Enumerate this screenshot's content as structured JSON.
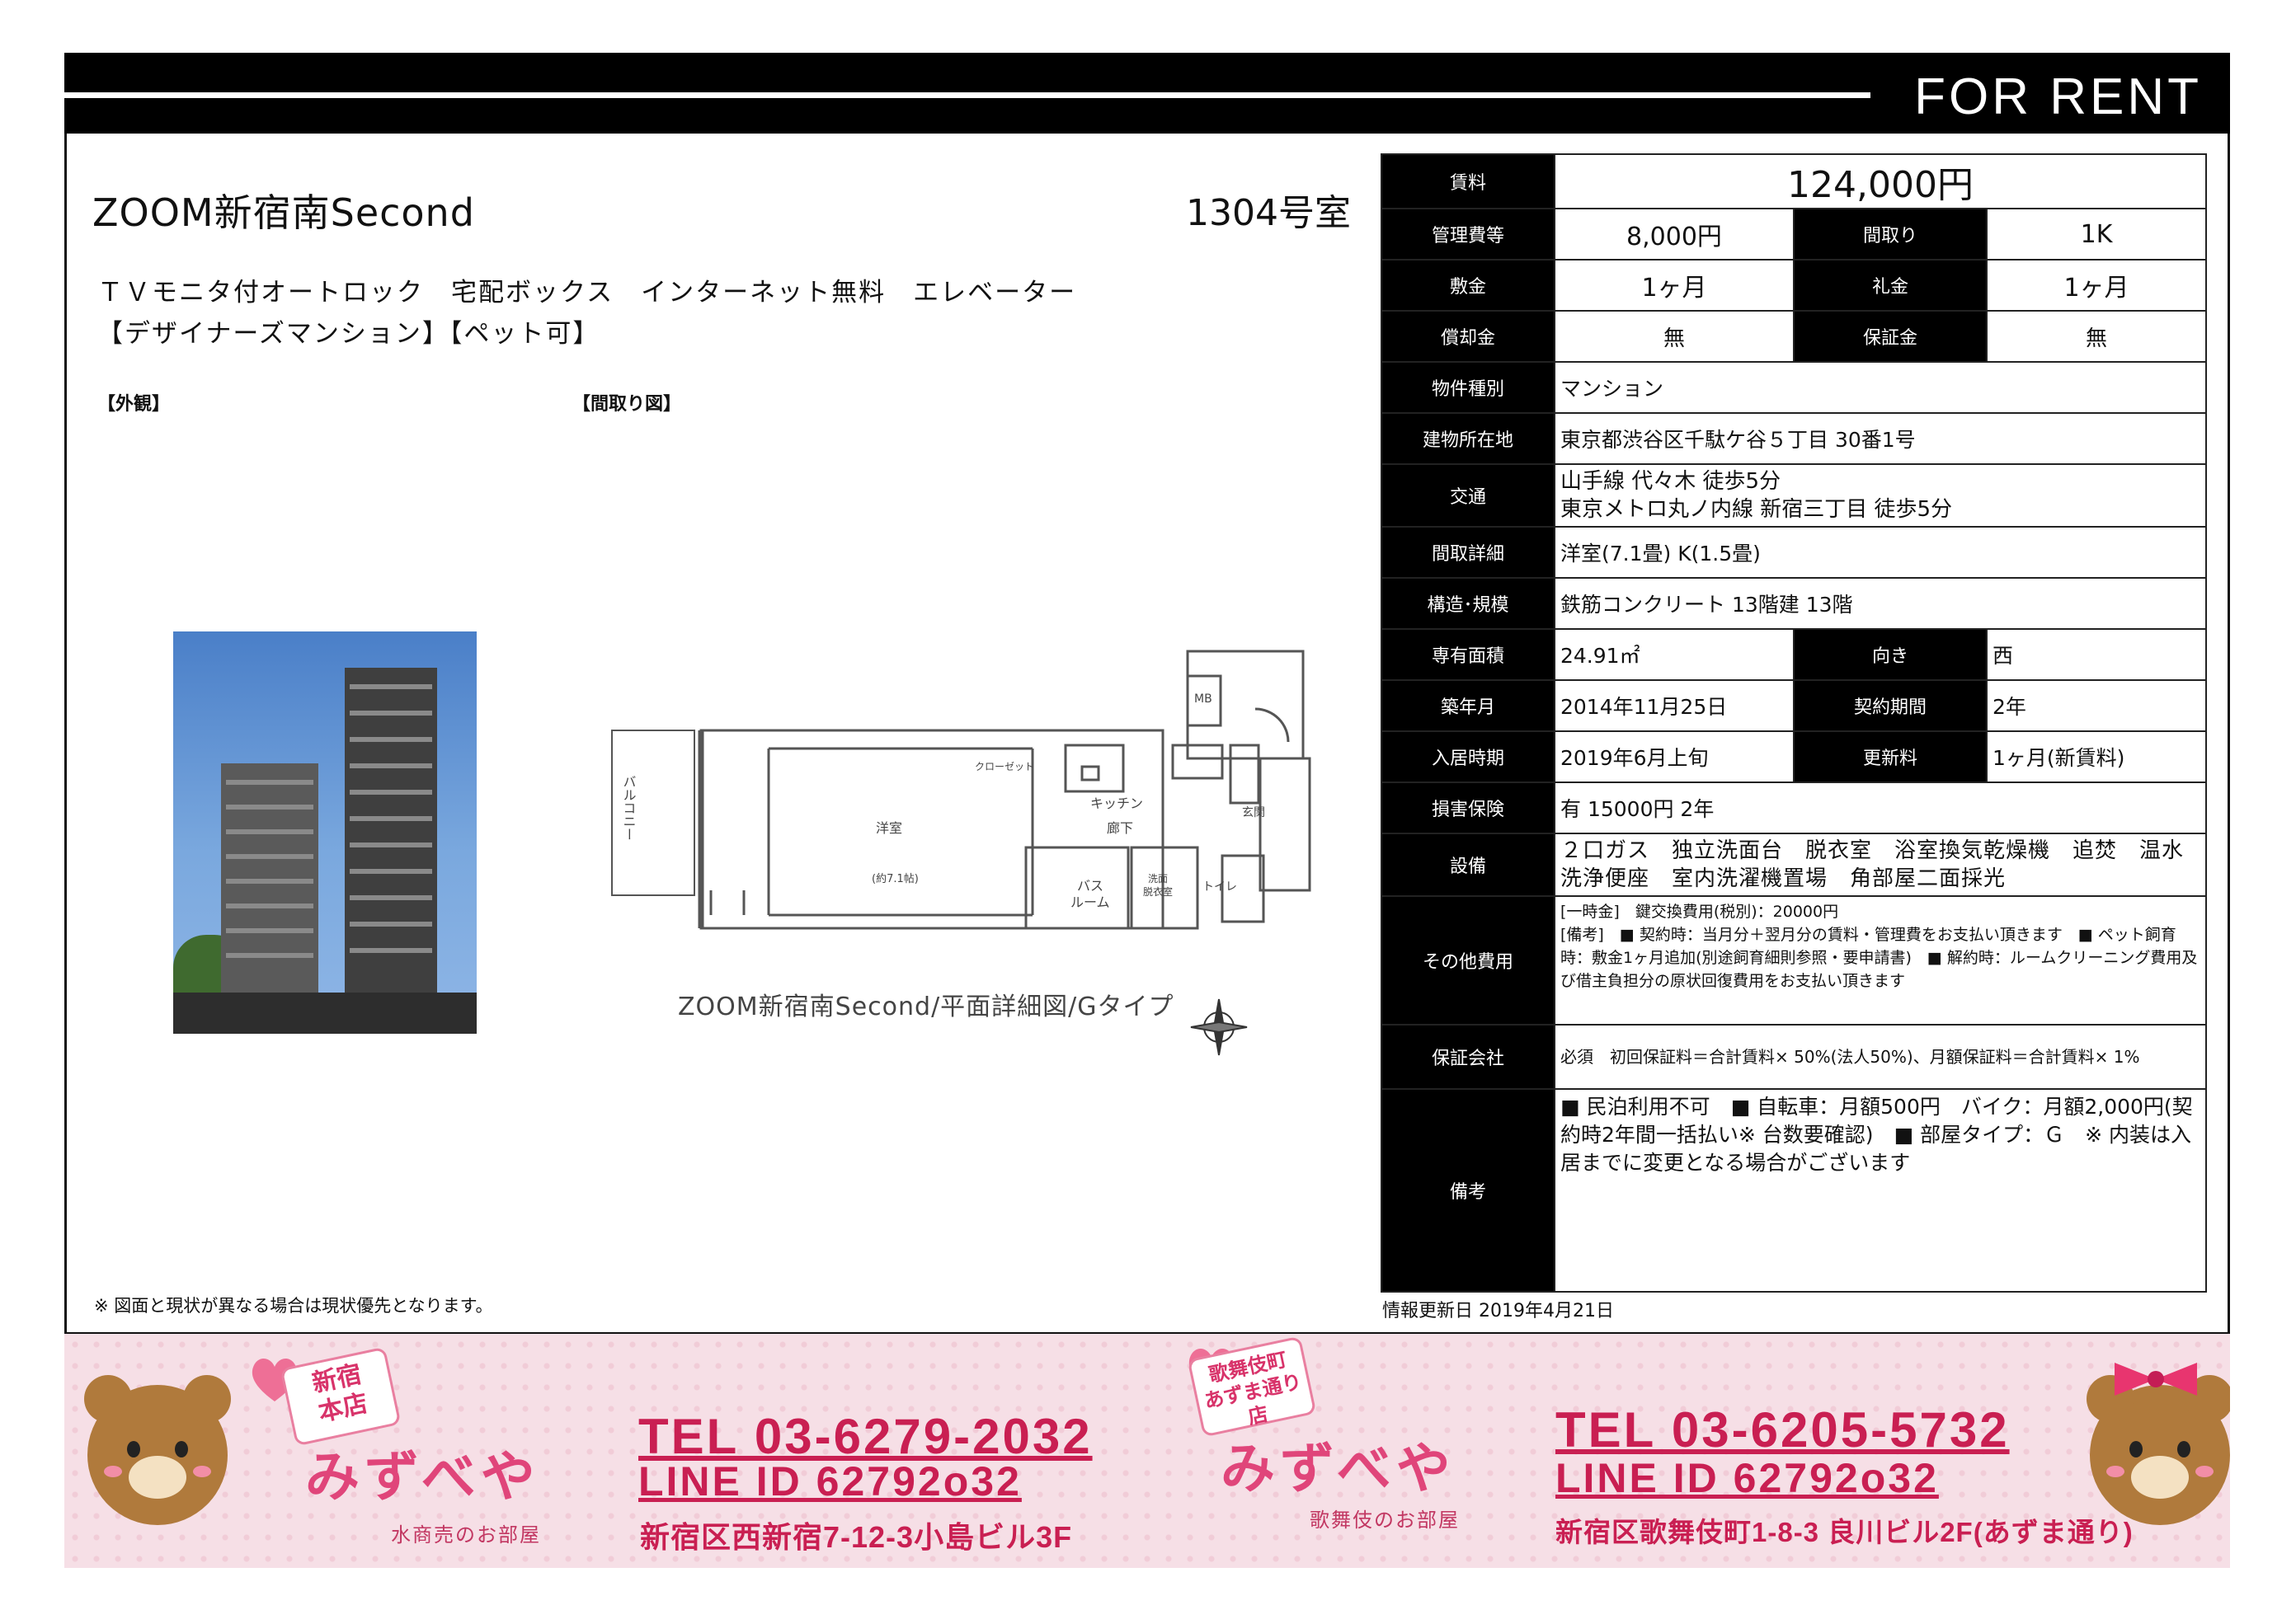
{
  "header": {
    "label": "FOR RENT"
  },
  "property": {
    "name": "ZOOM新宿南Second",
    "room": "1304号室",
    "features_line1": "ＴＶモニタ付オートロック　宅配ボックス　インターネット無料　エレベーター",
    "features_line2": "【デザイナーズマンション】【ペット可】"
  },
  "labels": {
    "exterior": "【外観】",
    "floorplan": "【間取り図】",
    "floorplan_caption": "ZOOM新宿南Second/平面詳細図/Gタイプ",
    "footnote": "※ 図面と現状が異なる場合は現状優先となります。"
  },
  "floorplan_text": {
    "room": "洋室",
    "room_size": "(約7.1帖)",
    "kitchen": "キッチン",
    "hall": "廊下",
    "bath": "バス\nルーム",
    "balcony": "バルコニー",
    "closet": "クローゼット",
    "entrance": "玄関",
    "toilet": "トイレ",
    "washroom": "洗面\n脱衣室",
    "mb": "MB"
  },
  "table": {
    "rent_label": "賃料",
    "rent": "124,000円",
    "mgmt_label": "管理費等",
    "mgmt": "8,000円",
    "layout_label": "間取り",
    "layout": "1K",
    "deposit_label": "敷金",
    "deposit": "1ヶ月",
    "key_money_label": "礼金",
    "key_money": "1ヶ月",
    "amort_label": "償却金",
    "amort": "無",
    "guarantee_label": "保証金",
    "guarantee": "無",
    "type_label": "物件種別",
    "type": "マンション",
    "address_label": "建物所在地",
    "address": "東京都渋谷区千駄ケ谷５丁目 30番1号",
    "transit_label": "交通",
    "transit1": "山手線 代々木 徒歩5分",
    "transit2": "東京メトロ丸ノ内線 新宿三丁目 徒歩5分",
    "layout_detail_label": "間取詳細",
    "layout_detail": "洋室(7.1畳) K(1.5畳)",
    "structure_label": "構造･規模",
    "structure": "鉄筋コンクリート 13階建 13階",
    "area_label": "専有面積",
    "area": "24.91㎡",
    "direction_label": "向き",
    "direction": "西",
    "built_label": "築年月",
    "built": "2014年11月25日",
    "term_label": "契約期間",
    "term": "2年",
    "movein_label": "入居時期",
    "movein": "2019年6月上旬",
    "renewal_label": "更新料",
    "renewal": "1ヶ月(新賃料)",
    "insurance_label": "損害保険",
    "insurance": "有  15000円 2年",
    "equipment_label": "設備",
    "equipment": "２口ガス　独立洗面台　脱衣室　浴室換気乾燥機　追焚　温水洗浄便座　室内洗濯機置場　角部屋二面採光",
    "other_label": "その他費用",
    "other1": "[一時金]　鍵交換費用(税別)：20000円",
    "other2": "[備考]　■ 契約時：当月分＋翌月分の賃料・管理費をお支払い頂きます　■ ペット飼育時：敷金1ヶ月追加(別途飼育細則参照・要申請書)　■ 解約時：ルームクリーニング費用及び借主負担分の原状回復費用をお支払い頂きます",
    "guarantor_label": "保証会社",
    "guarantor": "必須　初回保証料＝合計賃料× 50%(法人50%)、月額保証料＝合計賃料× 1%",
    "notes_label": "備考",
    "notes": "■ 民泊利用不可　■ 自転車：月額500円　バイク：月額2,000円(契約時2年間一括払い※ 台数要確認)　■ 部屋タイプ：Ｇ　※ 内装は入居までに変更となる場合がございます"
  },
  "update": "情報更新日 2019年4月21日",
  "banner": {
    "sign1": "新宿\n本店",
    "sign2": "歌舞伎町\nあずま通り店",
    "brand1": "みずべや",
    "sub1": "水商売のお部屋",
    "tel1": "TEL 03-6279-2032",
    "line1": "LINE ID 62792o32",
    "addr1": "新宿区西新宿7-12-3小島ビル3F",
    "brand2": "みずべや",
    "sub2": "歌舞伎のお部屋",
    "tel2": "TEL 03-6205-5732",
    "line2": "LINE ID 62792o32",
    "addr2": "新宿区歌舞伎町1-8-3 良川ビル2F(あずま通り)"
  },
  "colors": {
    "accent": "#c91f52",
    "banner_bg": "#f6dfe6"
  }
}
